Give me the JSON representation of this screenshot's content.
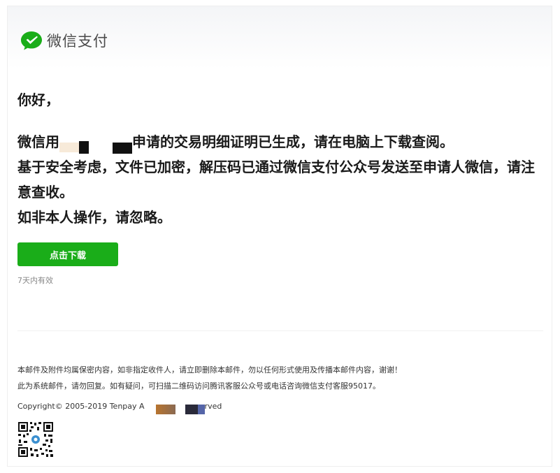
{
  "header": {
    "logo_text": "微信支付",
    "brand_color": "#1aad19"
  },
  "body": {
    "greeting": "你好，",
    "line1_prefix": "微信用",
    "line1_suffix": "申请的交易明细证明已生成，请在电脑上下载查阅。",
    "line2": "基于安全考虑，文件已加密，解压码已通过微信支付公众号发送至申请人微信，请注意查收。",
    "line3": "如非本人操作，请忽略。"
  },
  "download_button": {
    "label": "点击下载",
    "color": "#1aad19"
  },
  "validity_note": "7天内有效",
  "footer": {
    "notice1": "本邮件及附件均属保密内容，如非指定收件人，请立即删除本邮件，勿以任何形式使用及传播本邮件内容，谢谢！",
    "notice2": "此为系统邮件，请勿回复。如有疑问，可扫描二维码访问腾讯客服公众号或电话咨询微信支付客服95017。",
    "copyright_prefix": "Copyright© 2005-2019 Tenpay A",
    "copyright_suffix": "rved"
  },
  "icons": {
    "logo": "wechat-pay-check-bubble-icon",
    "qr": "qr-code-icon"
  }
}
